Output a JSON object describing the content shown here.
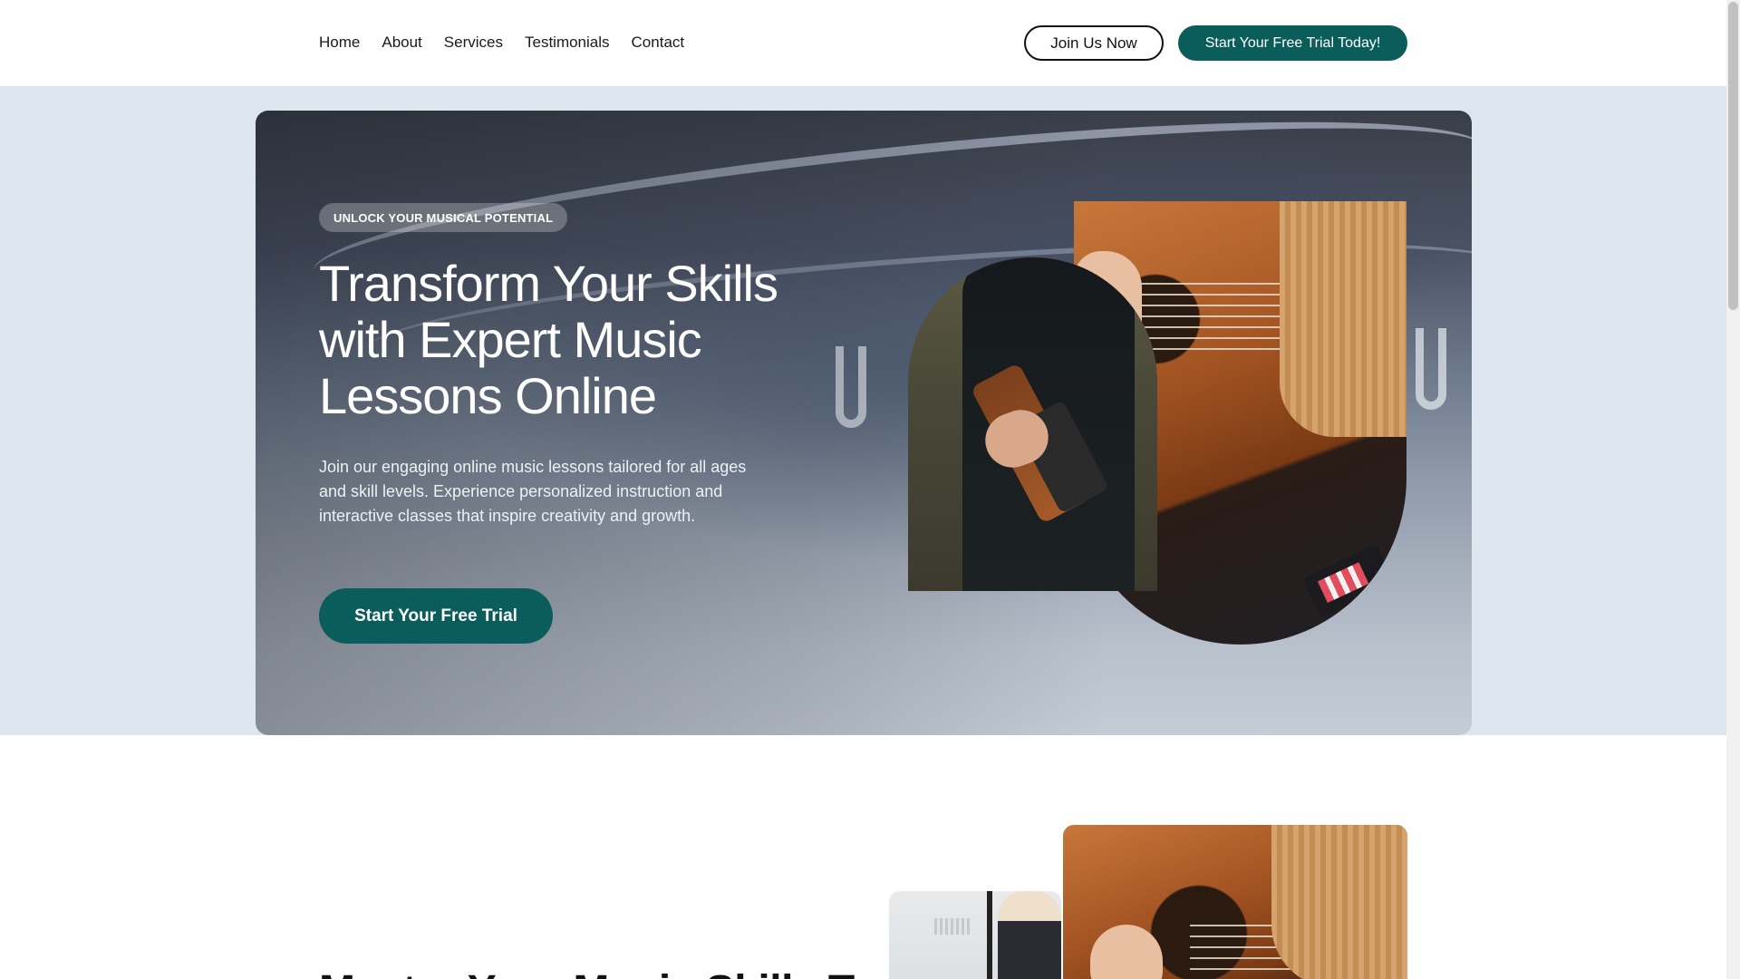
{
  "nav": {
    "items": [
      "Home",
      "About",
      "Services",
      "Testimonials",
      "Contact"
    ]
  },
  "header": {
    "join_label": "Join Us Now",
    "trial_label": "Start Your Free Trial Today!"
  },
  "hero": {
    "badge": "UNLOCK YOUR MUSICAL POTENTIAL",
    "title": "Transform Your Skills with Expert Music Lessons Online",
    "description": "Join our engaging online music lessons tailored for all ages and skill levels. Experience personalized instruction and interactive classes that inspire creativity and growth.",
    "cta_label": "Start Your Free Trial"
  },
  "section2": {
    "title": "Master Your Music Skills Today"
  },
  "colors": {
    "brand": "#0b5d5b",
    "hero_band": "#dde5ee"
  }
}
